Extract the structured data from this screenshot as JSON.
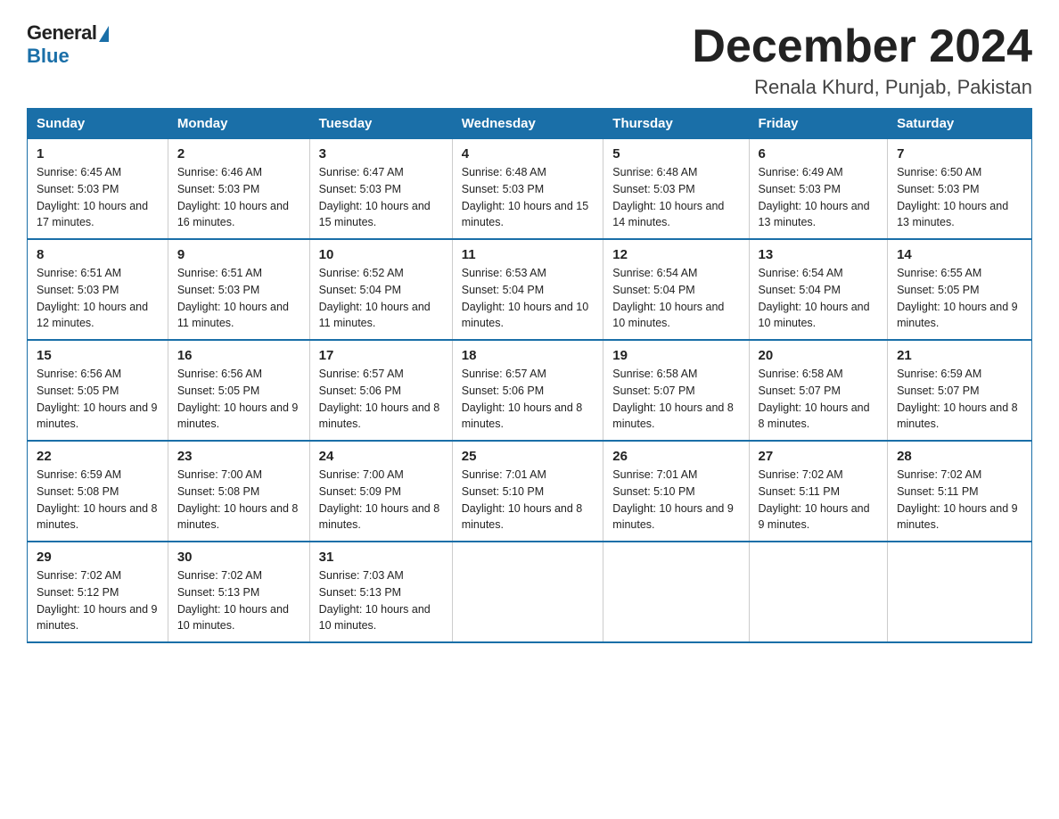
{
  "header": {
    "logo_general": "General",
    "logo_blue": "Blue",
    "month_title": "December 2024",
    "location": "Renala Khurd, Punjab, Pakistan"
  },
  "weekdays": [
    "Sunday",
    "Monday",
    "Tuesday",
    "Wednesday",
    "Thursday",
    "Friday",
    "Saturday"
  ],
  "weeks": [
    [
      {
        "day": "1",
        "sunrise": "6:45 AM",
        "sunset": "5:03 PM",
        "daylight": "10 hours and 17 minutes."
      },
      {
        "day": "2",
        "sunrise": "6:46 AM",
        "sunset": "5:03 PM",
        "daylight": "10 hours and 16 minutes."
      },
      {
        "day": "3",
        "sunrise": "6:47 AM",
        "sunset": "5:03 PM",
        "daylight": "10 hours and 15 minutes."
      },
      {
        "day": "4",
        "sunrise": "6:48 AM",
        "sunset": "5:03 PM",
        "daylight": "10 hours and 15 minutes."
      },
      {
        "day": "5",
        "sunrise": "6:48 AM",
        "sunset": "5:03 PM",
        "daylight": "10 hours and 14 minutes."
      },
      {
        "day": "6",
        "sunrise": "6:49 AM",
        "sunset": "5:03 PM",
        "daylight": "10 hours and 13 minutes."
      },
      {
        "day": "7",
        "sunrise": "6:50 AM",
        "sunset": "5:03 PM",
        "daylight": "10 hours and 13 minutes."
      }
    ],
    [
      {
        "day": "8",
        "sunrise": "6:51 AM",
        "sunset": "5:03 PM",
        "daylight": "10 hours and 12 minutes."
      },
      {
        "day": "9",
        "sunrise": "6:51 AM",
        "sunset": "5:03 PM",
        "daylight": "10 hours and 11 minutes."
      },
      {
        "day": "10",
        "sunrise": "6:52 AM",
        "sunset": "5:04 PM",
        "daylight": "10 hours and 11 minutes."
      },
      {
        "day": "11",
        "sunrise": "6:53 AM",
        "sunset": "5:04 PM",
        "daylight": "10 hours and 10 minutes."
      },
      {
        "day": "12",
        "sunrise": "6:54 AM",
        "sunset": "5:04 PM",
        "daylight": "10 hours and 10 minutes."
      },
      {
        "day": "13",
        "sunrise": "6:54 AM",
        "sunset": "5:04 PM",
        "daylight": "10 hours and 10 minutes."
      },
      {
        "day": "14",
        "sunrise": "6:55 AM",
        "sunset": "5:05 PM",
        "daylight": "10 hours and 9 minutes."
      }
    ],
    [
      {
        "day": "15",
        "sunrise": "6:56 AM",
        "sunset": "5:05 PM",
        "daylight": "10 hours and 9 minutes."
      },
      {
        "day": "16",
        "sunrise": "6:56 AM",
        "sunset": "5:05 PM",
        "daylight": "10 hours and 9 minutes."
      },
      {
        "day": "17",
        "sunrise": "6:57 AM",
        "sunset": "5:06 PM",
        "daylight": "10 hours and 8 minutes."
      },
      {
        "day": "18",
        "sunrise": "6:57 AM",
        "sunset": "5:06 PM",
        "daylight": "10 hours and 8 minutes."
      },
      {
        "day": "19",
        "sunrise": "6:58 AM",
        "sunset": "5:07 PM",
        "daylight": "10 hours and 8 minutes."
      },
      {
        "day": "20",
        "sunrise": "6:58 AM",
        "sunset": "5:07 PM",
        "daylight": "10 hours and 8 minutes."
      },
      {
        "day": "21",
        "sunrise": "6:59 AM",
        "sunset": "5:07 PM",
        "daylight": "10 hours and 8 minutes."
      }
    ],
    [
      {
        "day": "22",
        "sunrise": "6:59 AM",
        "sunset": "5:08 PM",
        "daylight": "10 hours and 8 minutes."
      },
      {
        "day": "23",
        "sunrise": "7:00 AM",
        "sunset": "5:08 PM",
        "daylight": "10 hours and 8 minutes."
      },
      {
        "day": "24",
        "sunrise": "7:00 AM",
        "sunset": "5:09 PM",
        "daylight": "10 hours and 8 minutes."
      },
      {
        "day": "25",
        "sunrise": "7:01 AM",
        "sunset": "5:10 PM",
        "daylight": "10 hours and 8 minutes."
      },
      {
        "day": "26",
        "sunrise": "7:01 AM",
        "sunset": "5:10 PM",
        "daylight": "10 hours and 9 minutes."
      },
      {
        "day": "27",
        "sunrise": "7:02 AM",
        "sunset": "5:11 PM",
        "daylight": "10 hours and 9 minutes."
      },
      {
        "day": "28",
        "sunrise": "7:02 AM",
        "sunset": "5:11 PM",
        "daylight": "10 hours and 9 minutes."
      }
    ],
    [
      {
        "day": "29",
        "sunrise": "7:02 AM",
        "sunset": "5:12 PM",
        "daylight": "10 hours and 9 minutes."
      },
      {
        "day": "30",
        "sunrise": "7:02 AM",
        "sunset": "5:13 PM",
        "daylight": "10 hours and 10 minutes."
      },
      {
        "day": "31",
        "sunrise": "7:03 AM",
        "sunset": "5:13 PM",
        "daylight": "10 hours and 10 minutes."
      },
      null,
      null,
      null,
      null
    ]
  ]
}
